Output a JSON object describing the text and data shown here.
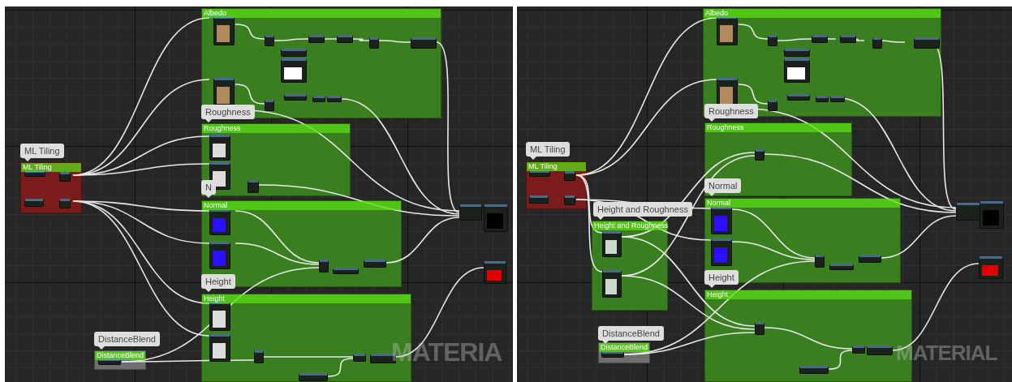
{
  "panels": [
    {
      "groups": [
        {
          "label": "Albedo",
          "color": "#3a7f1f"
        },
        {
          "label": "Roughness",
          "color": "#3a7f1f"
        },
        {
          "label": "Normal",
          "color": "#3a7f1f"
        },
        {
          "label": "Height",
          "color": "#3a7f1f"
        },
        {
          "label": "ML Tiling",
          "color": "#7a1c1c"
        },
        {
          "label": "DistanceBlend",
          "color": "#6e6e6e"
        }
      ],
      "bubbles": [
        "ML Tiling",
        "Roughness",
        "N",
        "Height",
        "DistanceBlend"
      ],
      "watermark": "MATERIA"
    },
    {
      "groups": [
        {
          "label": "Albedo",
          "color": "#3a7f1f"
        },
        {
          "label": "Roughness",
          "color": "#3a7f1f"
        },
        {
          "label": "Normal",
          "color": "#3a7f1f"
        },
        {
          "label": "Height",
          "color": "#3a7f1f"
        },
        {
          "label": "ML Tiling",
          "color": "#7a1c1c"
        },
        {
          "label": "Height and Roughness",
          "color": "#3a7f1f"
        },
        {
          "label": "DistanceBlend",
          "color": "#6e6e6e"
        }
      ],
      "bubbles": [
        "ML Tiling",
        "Roughness",
        "Normal",
        "Height and Roughness",
        "Height",
        "DistanceBlend"
      ],
      "watermark": "MATERIAL"
    }
  ]
}
